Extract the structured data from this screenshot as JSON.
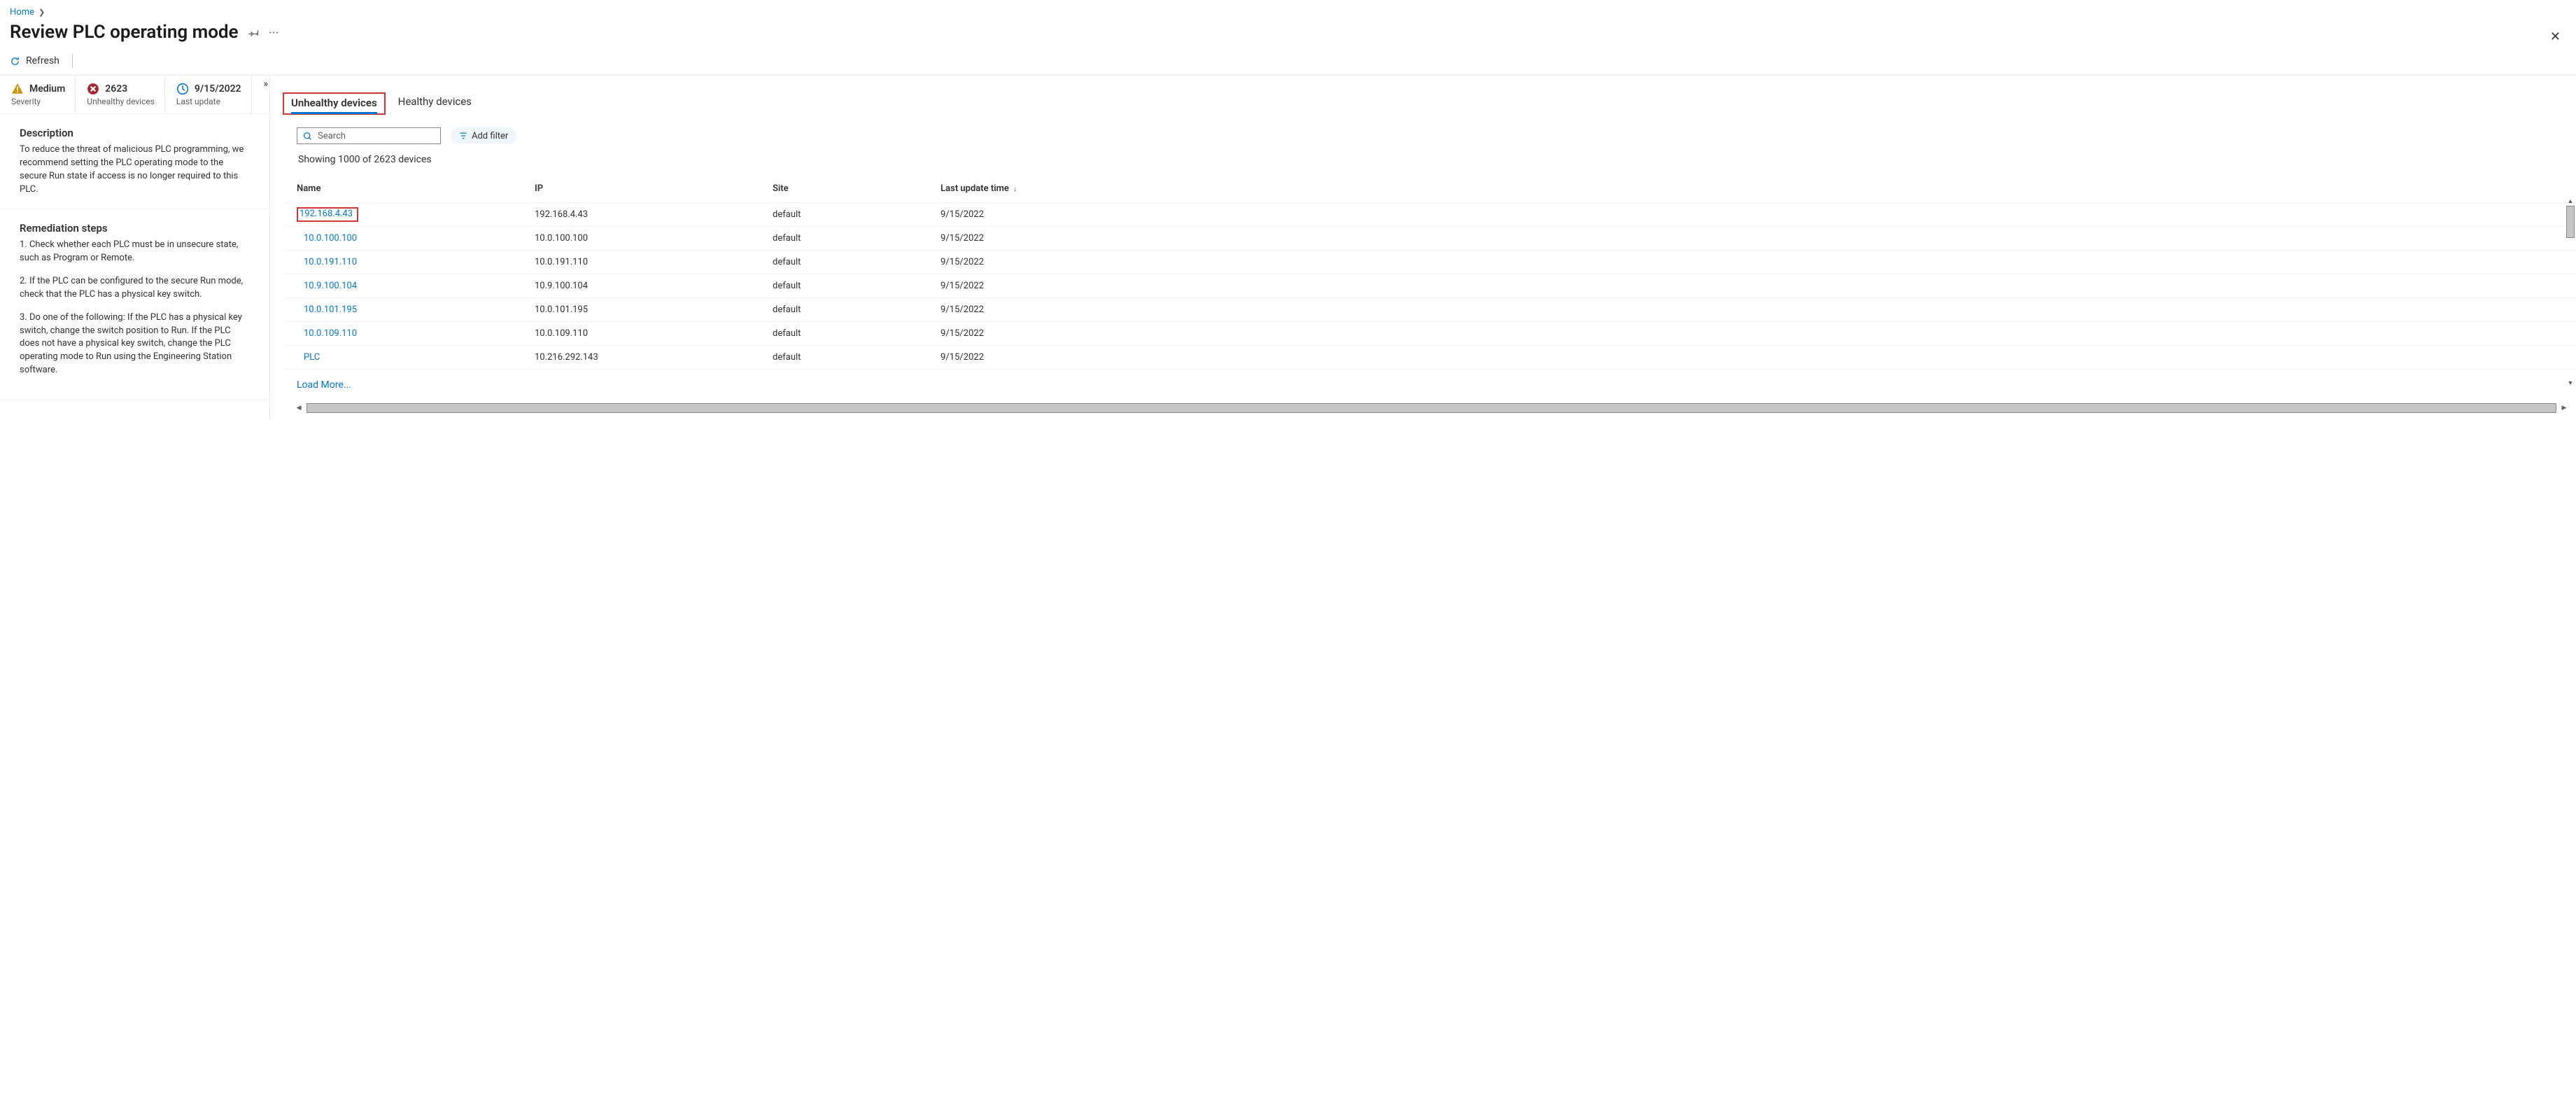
{
  "breadcrumb": {
    "home": "Home"
  },
  "title": "Review PLC operating mode",
  "commands": {
    "refresh": "Refresh"
  },
  "severity": {
    "value": "Medium",
    "label": "Severity"
  },
  "unhealthy": {
    "value": "2623",
    "label": "Unhealthy devices"
  },
  "lastupdate": {
    "value": "9/15/2022",
    "label": "Last update"
  },
  "description": {
    "heading": "Description",
    "body": "To reduce the threat of malicious PLC programming, we recommend setting the PLC operating mode to the secure Run state if access is no longer required to this PLC."
  },
  "remediation": {
    "heading": "Remediation steps",
    "s1": "1. Check whether each PLC must be in unsecure state, such as Program or Remote.",
    "s2": "2. If the PLC can be configured to the secure Run mode, check that the PLC has a physical key switch.",
    "s3": "3. Do one of the following: If the PLC has a physical key switch, change the switch position to Run. If the PLC does not have a physical key switch, change the PLC operating mode to Run using the Engineering Station software."
  },
  "tabs": {
    "unhealthy": "Unhealthy devices",
    "healthy": "Healthy devices"
  },
  "search_placeholder": "Search",
  "add_filter": "Add filter",
  "showing_line": "Showing 1000 of 2623 devices",
  "columns": {
    "name": "Name",
    "ip": "IP",
    "site": "Site",
    "last": "Last update time"
  },
  "rows": [
    {
      "name": "192.168.4.43",
      "ip": "192.168.4.43",
      "site": "default",
      "last": "9/15/2022",
      "highlight": true
    },
    {
      "name": "10.0.100.100",
      "ip": "10.0.100.100",
      "site": "default",
      "last": "9/15/2022"
    },
    {
      "name": "10.0.191.110",
      "ip": "10.0.191.110",
      "site": "default",
      "last": "9/15/2022"
    },
    {
      "name": "10.9.100.104",
      "ip": "10.9.100.104",
      "site": "default",
      "last": "9/15/2022"
    },
    {
      "name": "10.0.101.195",
      "ip": "10.0.101.195",
      "site": "default",
      "last": "9/15/2022"
    },
    {
      "name": "10.0.109.110",
      "ip": "10.0.109.110",
      "site": "default",
      "last": "9/15/2022"
    },
    {
      "name": "PLC",
      "ip": "10.216.292.143",
      "site": "default",
      "last": "9/15/2022"
    }
  ],
  "load_more": "Load More..."
}
